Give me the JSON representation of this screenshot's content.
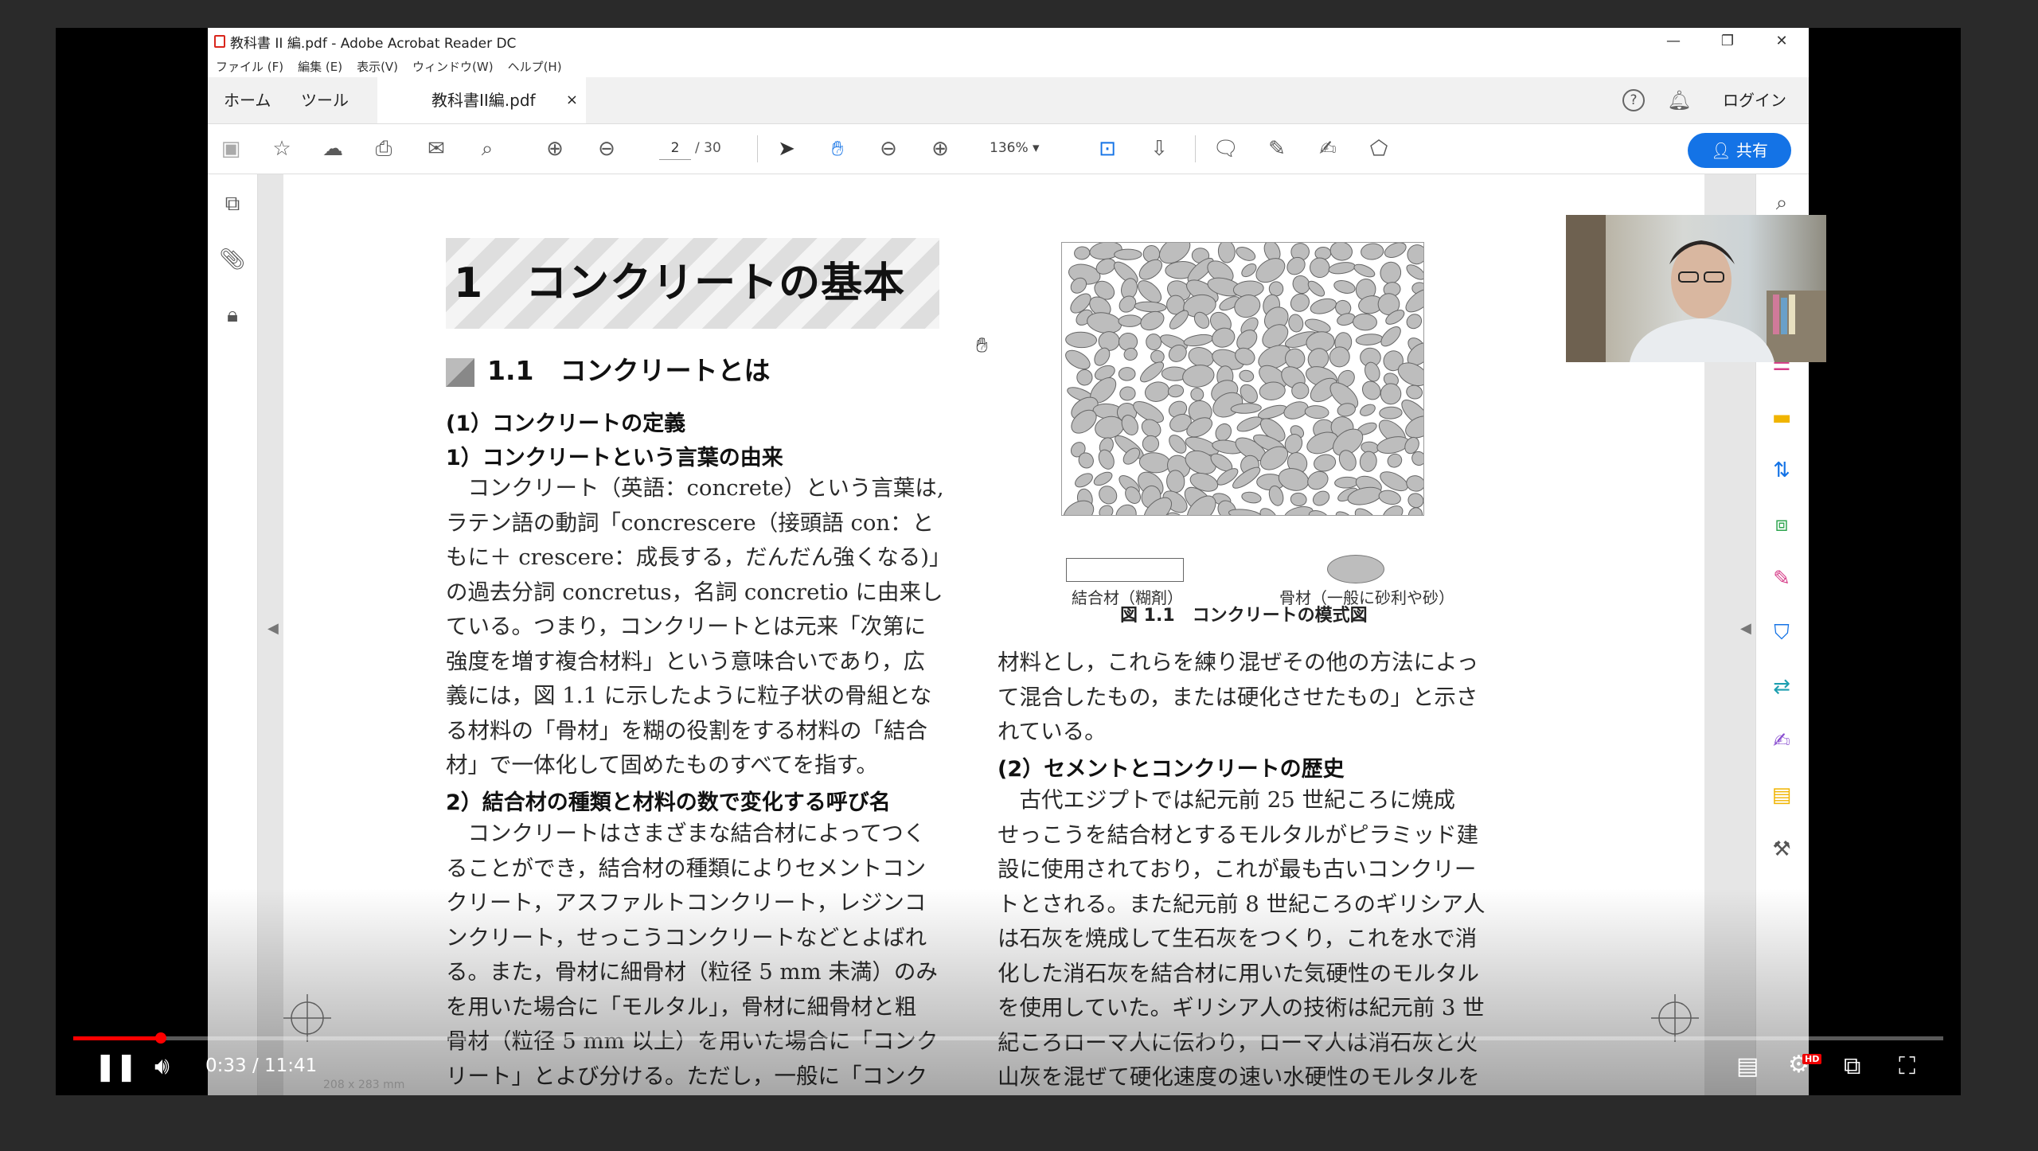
{
  "window": {
    "title": "教科書 II 編.pdf - Adobe Acrobat Reader DC",
    "controls": [
      "—",
      "❐",
      "✕"
    ]
  },
  "menu": [
    "ファイル (F)",
    "編集 (E)",
    "表示(V)",
    "ウィンドウ(W)",
    "ヘルプ(H)"
  ],
  "tabs": {
    "home": "ホーム",
    "tools": "ツール",
    "doc": "教科書II編.pdf",
    "close": "×"
  },
  "header_right": {
    "help": "?",
    "login": "ログイン"
  },
  "toolbar": {
    "page_current": "2",
    "page_total": "/ 30",
    "zoom": "136%",
    "share": "共有"
  },
  "document": {
    "chapter_title": "1　コンクリートの基本",
    "section_title": "1.1　コンクリートとは",
    "sub1": "(1）コンクリートの定義",
    "sub1_1": "1）コンクリートという言葉の由来",
    "left_para1": [
      "　コンクリート（英語：concrete）という言葉は,",
      "ラテン語の動詞「concrescere（接頭語 con：と",
      "もに＋ crescere：成長する，だんだん強くなる)」",
      "の過去分詞 concretus，名詞 concretio に由来し",
      "ている。つまり，コンクリートとは元来「次第に",
      "強度を増す複合材料」という意味合いであり，広",
      "義には，図 1.1 に示したように粒子状の骨組とな",
      "る材料の「骨材」を糊の役割をする材料の「結合",
      "材」で一体化して固めたものすべてを指す。"
    ],
    "sub1_2": "2）結合材の種類と材料の数で変化する呼び名",
    "left_para2": [
      "　コンクリートはさまざまな結合材によってつく",
      "ることができ，結合材の種類によりセメントコン",
      "クリート，アスファルトコンクリート，レジンコ",
      "ンクリート，せっこうコンクリートなどとよばれ",
      "る。また，骨材に細骨材（粒径 5 mm 未満）のみ",
      "を用いた場合に「モルタル」，骨材に細骨材と粗",
      "骨材（粒径 5 mm 以上）を用いた場合に「コンク",
      "リート」とよび分ける。ただし，一般に「コンク"
    ],
    "legend_binder": "結合材（糊剤）",
    "legend_aggregate": "骨材（一般に砂利や砂）",
    "figure_caption": "図 1.1　コンクリートの模式図",
    "right_para1": [
      "材料とし，これらを練り混ぜその他の方法によっ",
      "て混合したもの，または硬化させたもの」と示さ",
      "れている。"
    ],
    "sub2": "(2）セメントとコンクリートの歴史",
    "right_para2": [
      "　古代エジプトでは紀元前 25 世紀ころに焼成",
      "せっこうを結合材とするモルタルがピラミッド建",
      "設に使用されており，これが最も古いコンクリー",
      "トとされる。また紀元前 8 世紀ころのギリシア人",
      "は石灰を焼成して生石灰をつくり，これを水で消",
      "化した消石灰を結合材に用いた気硬性のモルタル",
      "を使用していた。ギリシア人の技術は紀元前 3 世",
      "紀ころローマ人に伝わり，ローマ人は消石灰と火",
      "山灰を混ぜて硬化速度の速い水硬性のモルタルを"
    ]
  },
  "statusbar": {
    "page_size": "208 x 283 mm"
  },
  "video": {
    "time": "0:33 / 11:41",
    "progress": 0.047,
    "hd_badge": "HD",
    "accent": "#ff0000"
  }
}
